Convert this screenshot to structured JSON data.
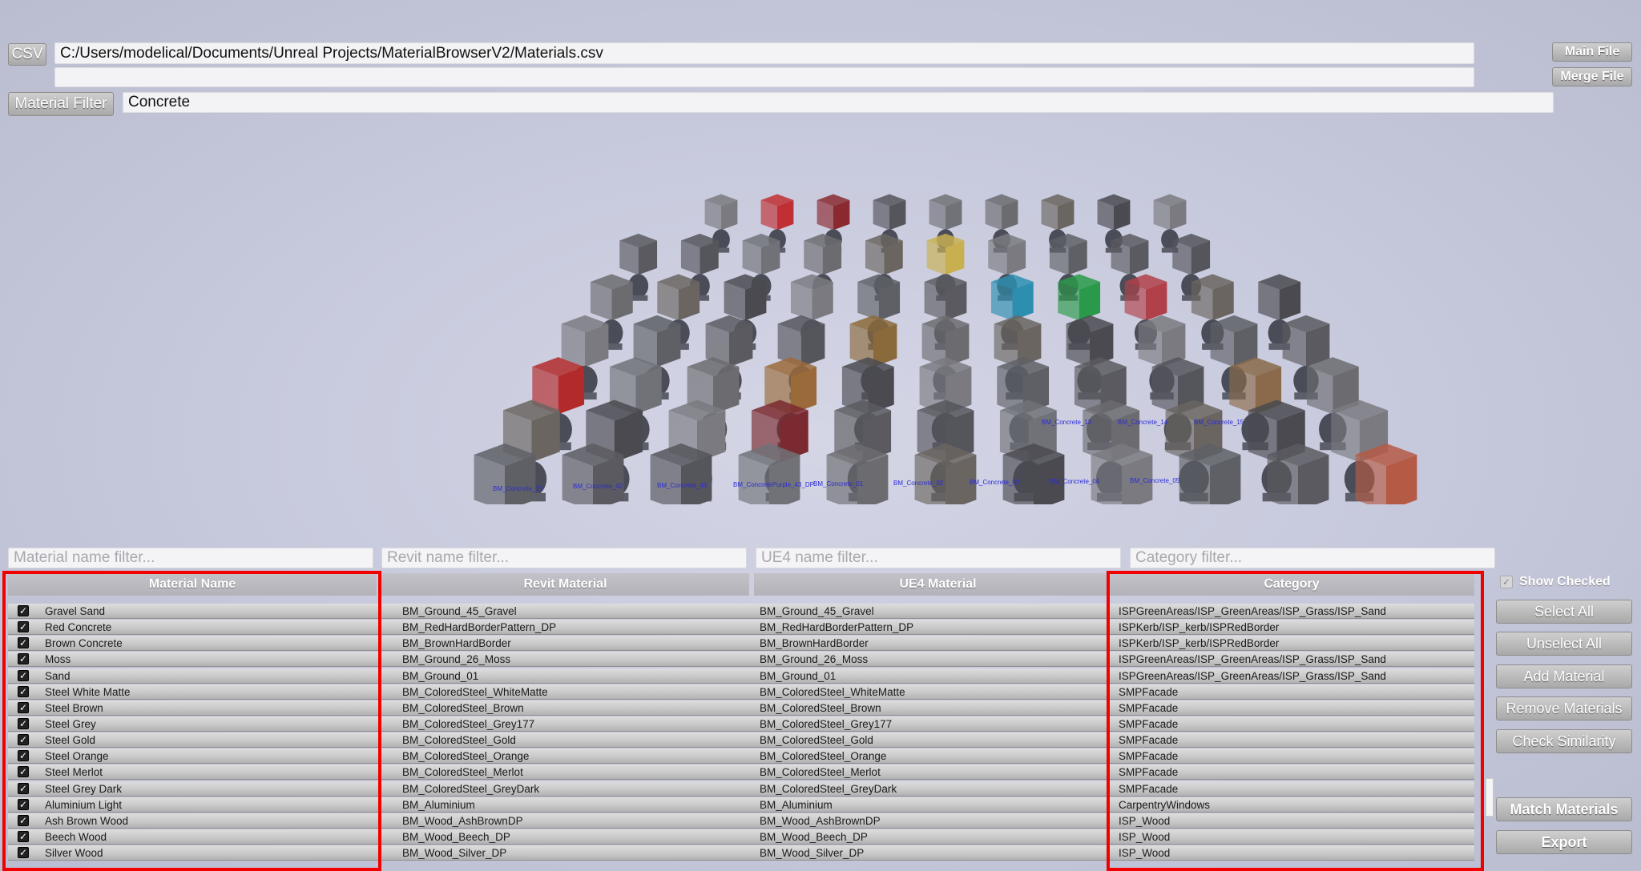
{
  "csv": {
    "button_label": "CSV",
    "path": "C:/Users/modelical/Documents/Unreal Projects/MaterialBrowserV2/Materials.csv",
    "second_path": ""
  },
  "file_buttons": {
    "main_file": "Main File",
    "merge_file": "Merge File"
  },
  "material_filter": {
    "button_label": "Material Filter",
    "value": "Concrete"
  },
  "viewport": {
    "labels": [
      "BM_Concrete_23",
      "BM_Concrete_42",
      "BM_Concrete_43",
      "BM_ConcretePurple_43_DP",
      "BM_Concrete_01",
      "BM_Concrete_02",
      "BM_Concrete_03",
      "BM_Concrete_04",
      "BM_Concrete_05",
      "BM_Concrete_13",
      "BM_Concrete_14",
      "BM_Concrete_15"
    ]
  },
  "filters": {
    "material_name_placeholder": "Material name filter...",
    "revit_name_placeholder": "Revit name filter...",
    "ue4_name_placeholder": "UE4 name filter...",
    "category_placeholder": "Category filter..."
  },
  "columns": {
    "material_name": "Material Name",
    "revit_material": "Revit Material",
    "ue4_material": "UE4 Material",
    "category": "Category"
  },
  "rows": [
    {
      "name": "Gravel Sand",
      "revit": "BM_Ground_45_Gravel",
      "ue4": "BM_Ground_45_Gravel",
      "category": "ISPGreenAreas/ISP_GreenAreas/ISP_Grass/ISP_Sand",
      "checked": true
    },
    {
      "name": "Red Concrete",
      "revit": "BM_RedHardBorderPattern_DP",
      "ue4": "BM_RedHardBorderPattern_DP",
      "category": "ISPKerb/ISP_kerb/ISPRedBorder",
      "checked": true
    },
    {
      "name": "Brown Concrete",
      "revit": "BM_BrownHardBorder",
      "ue4": "BM_BrownHardBorder",
      "category": "ISPKerb/ISP_kerb/ISPRedBorder",
      "checked": true
    },
    {
      "name": "Moss",
      "revit": "BM_Ground_26_Moss",
      "ue4": "BM_Ground_26_Moss",
      "category": "ISPGreenAreas/ISP_GreenAreas/ISP_Grass/ISP_Sand",
      "checked": true
    },
    {
      "name": "Sand",
      "revit": "BM_Ground_01",
      "ue4": "BM_Ground_01",
      "category": "ISPGreenAreas/ISP_GreenAreas/ISP_Grass/ISP_Sand",
      "checked": true
    },
    {
      "name": "Steel White Matte",
      "revit": "BM_ColoredSteel_WhiteMatte",
      "ue4": "BM_ColoredSteel_WhiteMatte",
      "category": "SMPFacade",
      "checked": true
    },
    {
      "name": "Steel Brown",
      "revit": "BM_ColoredSteel_Brown",
      "ue4": "BM_ColoredSteel_Brown",
      "category": "SMPFacade",
      "checked": true
    },
    {
      "name": "Steel Grey",
      "revit": "BM_ColoredSteel_Grey177",
      "ue4": "BM_ColoredSteel_Grey177",
      "category": "SMPFacade",
      "checked": true
    },
    {
      "name": "Steel Gold",
      "revit": "BM_ColoredSteel_Gold",
      "ue4": "BM_ColoredSteel_Gold",
      "category": "SMPFacade",
      "checked": true
    },
    {
      "name": "Steel Orange",
      "revit": "BM_ColoredSteel_Orange",
      "ue4": "BM_ColoredSteel_Orange",
      "category": "SMPFacade",
      "checked": true
    },
    {
      "name": "Steel Merlot",
      "revit": "BM_ColoredSteel_Merlot",
      "ue4": "BM_ColoredSteel_Merlot",
      "category": "SMPFacade",
      "checked": true
    },
    {
      "name": "Steel Grey Dark",
      "revit": "BM_ColoredSteel_GreyDark",
      "ue4": "BM_ColoredSteel_GreyDark",
      "category": "SMPFacade",
      "checked": true
    },
    {
      "name": "Aluminium Light",
      "revit": "BM_Aluminium",
      "ue4": "BM_Aluminium",
      "category": "CarpentryWindows",
      "checked": true
    },
    {
      "name": "Ash Brown Wood",
      "revit": "BM_Wood_AshBrownDP",
      "ue4": "BM_Wood_AshBrownDP",
      "category": "ISP_Wood",
      "checked": true
    },
    {
      "name": "Beech Wood",
      "revit": "BM_Wood_Beech_DP",
      "ue4": "BM_Wood_Beech_DP",
      "category": "ISP_Wood",
      "checked": true
    },
    {
      "name": "Silver Wood",
      "revit": "BM_Wood_Silver_DP",
      "ue4": "BM_Wood_Silver_DP",
      "category": "ISP_Wood",
      "checked": true
    }
  ],
  "side_panel": {
    "show_checked_label": "Show Checked",
    "show_checked": true,
    "select_all": "Select All",
    "unselect_all": "Unselect All",
    "add_material": "Add Material",
    "remove_materials": "Remove Materials",
    "check_similarity": "Check Similarity",
    "match_materials": "Match Materials",
    "export": "Export"
  },
  "colors": {
    "highlight": "#f20000",
    "background": "#c6c8dc"
  }
}
